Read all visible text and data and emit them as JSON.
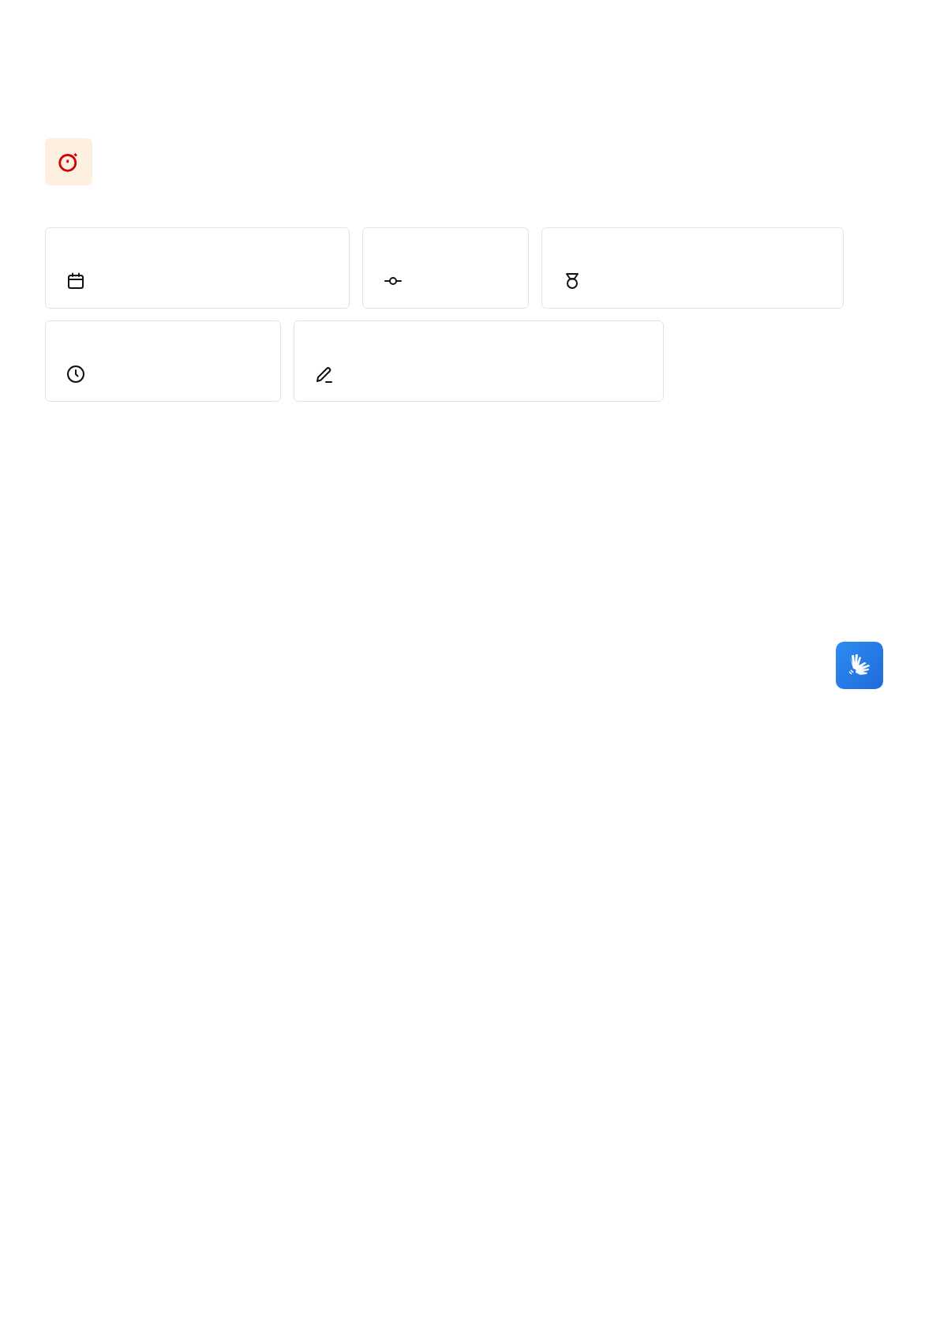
{
  "header": {
    "kind": "timer"
  },
  "cards": [
    {
      "kind": "date"
    },
    {
      "kind": "commit"
    },
    {
      "kind": "award"
    },
    {
      "kind": "time"
    },
    {
      "kind": "edit"
    }
  ],
  "accessibility_button": {
    "kind": "sign-language"
  }
}
